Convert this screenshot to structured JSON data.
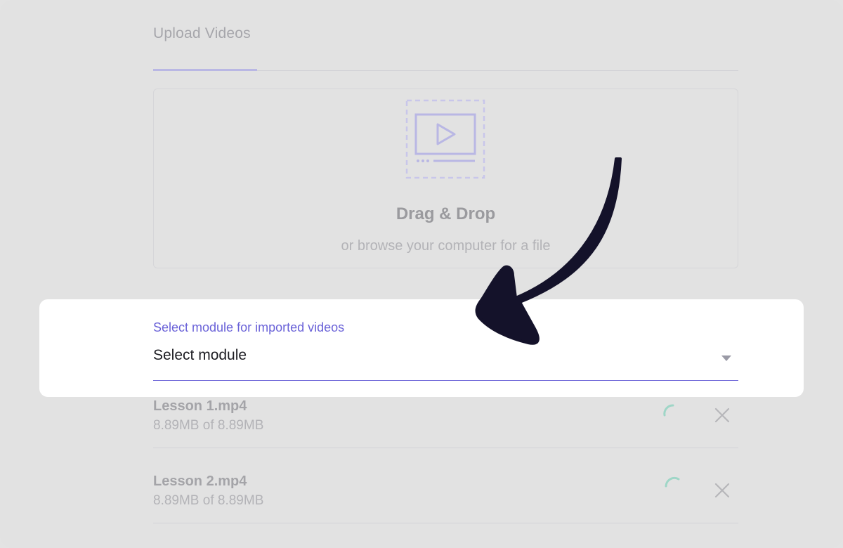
{
  "tabs": [
    {
      "label": "Upload Videos",
      "active": true
    }
  ],
  "dropzone": {
    "icon": "video-icon",
    "title": "Drag & Drop",
    "subtitle": "or browse your computer for a file"
  },
  "module_select": {
    "label": "Select module for imported videos",
    "value": "Select module",
    "icon": "chevron-down-icon"
  },
  "files": [
    {
      "name": "Lesson 1.mp4",
      "size": "8.89MB of 8.89MB",
      "status_icon": "loading-spinner-icon",
      "remove_icon": "close-icon"
    },
    {
      "name": "Lesson 2.mp4",
      "size": "8.89MB of 8.89MB",
      "status_icon": "loading-spinner-icon",
      "remove_icon": "close-icon"
    }
  ],
  "colors": {
    "accent": "#6a62d8",
    "accent_faded": "#b9b7e4",
    "spinner": "#9fd6c7",
    "overlay_background": "#e2e2e2",
    "arrow": "#14122a"
  }
}
